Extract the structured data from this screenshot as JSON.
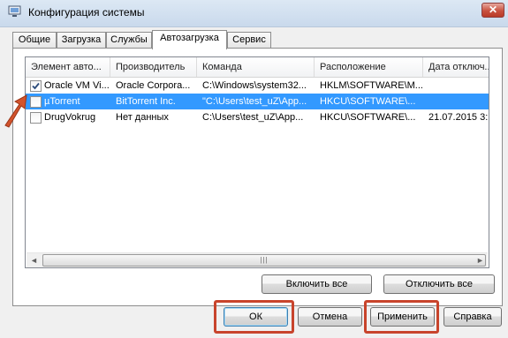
{
  "window": {
    "title": "Конфигурация системы",
    "close_symbol": "✕"
  },
  "tabs": [
    {
      "label": "Общие",
      "active": false
    },
    {
      "label": "Загрузка",
      "active": false
    },
    {
      "label": "Службы",
      "active": false
    },
    {
      "label": "Автозагрузка",
      "active": true
    },
    {
      "label": "Сервис",
      "active": false
    }
  ],
  "startup_list": {
    "columns": [
      "Элемент авто...",
      "Производитель",
      "Команда",
      "Расположение",
      "Дата отключ..."
    ],
    "rows": [
      {
        "checked": true,
        "selected": false,
        "cells": [
          "Oracle VM Vi...",
          "Oracle Corpora...",
          "C:\\Windows\\system32...",
          "HKLM\\SOFTWARE\\M...",
          ""
        ]
      },
      {
        "checked": false,
        "selected": true,
        "cells": [
          "µTorrent",
          "BitTorrent Inc.",
          "\"C:\\Users\\test_uZ\\App...",
          "HKCU\\SOFTWARE\\...",
          ""
        ]
      },
      {
        "checked": false,
        "selected": false,
        "cells": [
          "DrugVokrug",
          "Нет данных",
          "C:\\Users\\test_uZ\\App...",
          "HKCU\\SOFTWARE\\...",
          "21.07.2015 3:..."
        ]
      }
    ],
    "scroll_left_symbol": "◄",
    "scroll_right_symbol": "►",
    "scroll_grip": "|||"
  },
  "panel_buttons": {
    "enable_all": "Включить все",
    "disable_all": "Отключить все"
  },
  "dialog_buttons": {
    "ok": "ОК",
    "cancel": "Отмена",
    "apply": "Применить",
    "help": "Справка"
  },
  "colors": {
    "selection": "#3399ff",
    "highlight_frame": "#c8442c",
    "annotation_arrow": "#d2532c"
  },
  "icons": {
    "app": "msconfig-icon",
    "close": "close-icon",
    "checkmark": "checkmark-icon",
    "annotation": "red-arrow-icon"
  }
}
